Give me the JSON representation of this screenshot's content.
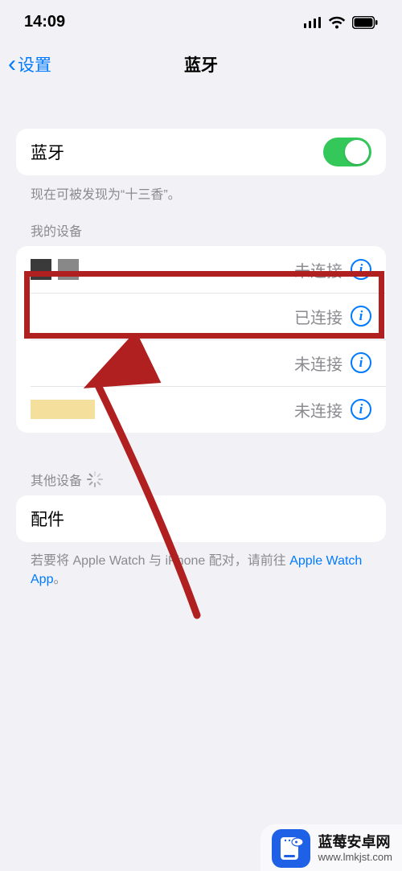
{
  "status": {
    "time": "14:09"
  },
  "nav": {
    "back_label": "设置",
    "title": "蓝牙"
  },
  "bluetooth": {
    "label": "蓝牙",
    "discoverable_text": "现在可被发现为“十三香”。"
  },
  "my_devices": {
    "header": "我的设备",
    "rows": [
      {
        "status": "未连接"
      },
      {
        "status": "已连接"
      },
      {
        "status": "未连接"
      },
      {
        "status": "未连接"
      }
    ]
  },
  "other_devices": {
    "header": "其他设备"
  },
  "accessories": {
    "label": "配件"
  },
  "hint": {
    "prefix": "若要将 Apple Watch 与 iPhone 配对，请前往",
    "link": "Apple Watch App",
    "suffix": "。"
  },
  "watermark": {
    "title": "蓝莓安卓网",
    "url": "www.lmkjst.com"
  }
}
